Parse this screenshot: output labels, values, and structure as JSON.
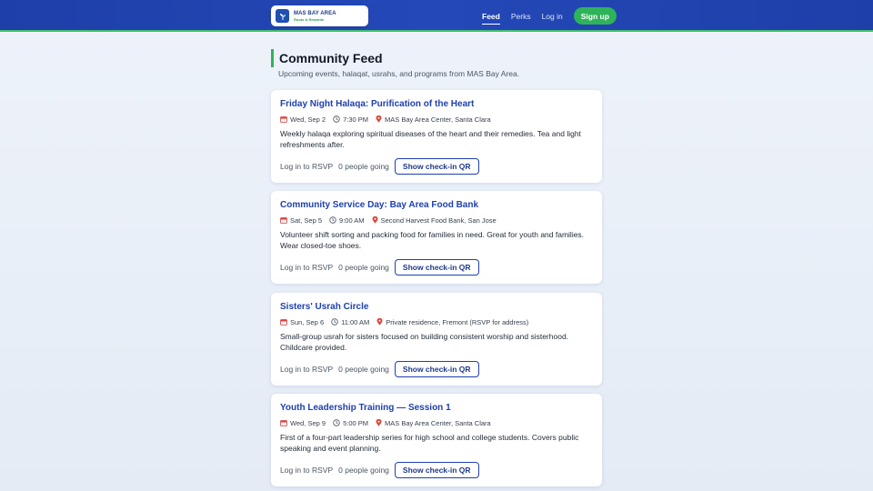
{
  "header": {
    "brand_name": "MAS BAY AREA",
    "brand_tagline": "Roots & Rewards",
    "nav": [
      {
        "label": "Feed",
        "active": true
      },
      {
        "label": "Perks",
        "active": false
      },
      {
        "label": "Log in",
        "active": false
      }
    ],
    "signup_label": "Sign up"
  },
  "page": {
    "title": "Community Feed",
    "subtitle": "Upcoming events, halaqat, usrahs, and programs from MAS Bay Area."
  },
  "events": [
    {
      "title": "Friday Night Halaqa: Purification of the Heart",
      "date": "Wed, Sep 2",
      "time": "7:30 PM",
      "location": "MAS Bay Area Center, Santa Clara",
      "description": "Weekly halaqa exploring spiritual diseases of the heart and their remedies. Tea and light refreshments after.",
      "rsvp_label": "Log in to RSVP",
      "going": "0 people going",
      "qr_label": "Show check-in QR"
    },
    {
      "title": "Community Service Day: Bay Area Food Bank",
      "date": "Sat, Sep 5",
      "time": "9:00 AM",
      "location": "Second Harvest Food Bank, San Jose",
      "description": "Volunteer shift sorting and packing food for families in need. Great for youth and families. Wear closed-toe shoes.",
      "rsvp_label": "Log in to RSVP",
      "going": "0 people going",
      "qr_label": "Show check-in QR"
    },
    {
      "title": "Sisters' Usrah Circle",
      "date": "Sun, Sep 6",
      "time": "11:00 AM",
      "location": "Private residence, Fremont (RSVP for address)",
      "description": "Small-group usrah for sisters focused on building consistent worship and sisterhood. Childcare provided.",
      "rsvp_label": "Log in to RSVP",
      "going": "0 people going",
      "qr_label": "Show check-in QR"
    },
    {
      "title": "Youth Leadership Training — Session 1",
      "date": "Wed, Sep 9",
      "time": "5:00 PM",
      "location": "MAS Bay Area Center, Santa Clara",
      "description": "First of a four-part leadership series for high school and college students. Covers public speaking and event planning.",
      "rsvp_label": "Log in to RSVP",
      "going": "0 people going",
      "qr_label": "Show check-in QR"
    }
  ],
  "icons": {
    "date": "calendar-icon",
    "time": "clock-icon",
    "location": "pin-icon",
    "brand": "leaf-logo-icon"
  },
  "colors": {
    "header": "#1e3fa7",
    "accent_green": "#2fb35a",
    "title_blue": "#1e40af"
  }
}
